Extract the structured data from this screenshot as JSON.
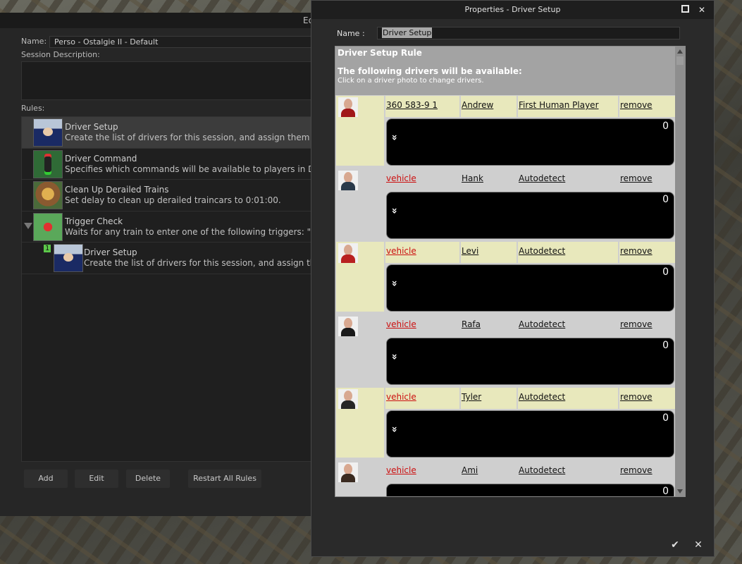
{
  "back_window": {
    "title_fragment": "Ed",
    "name_label": "Name:",
    "name_value": "Perso - Ostalgie II - Default",
    "session_description_label": "Session Description:",
    "rules_label": "Rules:",
    "rules": [
      {
        "title": "Driver Setup",
        "desc": "Create the list of drivers for this session, and assign them their o"
      },
      {
        "title": "Driver Command",
        "desc": "Specifies which commands will be available to players in Driver."
      },
      {
        "title": "Clean Up Derailed Trains",
        "desc": "Set delay to clean up derailed traincars to 0:01:00."
      },
      {
        "title": "Trigger Check",
        "desc": "Waits for any train to enter one of the following triggers: \"Cahlew"
      },
      {
        "title": "Driver Setup",
        "desc": "Create the list of drivers for this session, and assign them th",
        "child_index": "1"
      }
    ],
    "buttons": {
      "add": "Add",
      "edit": "Edit",
      "delete": "Delete",
      "restart": "Restart All Rules"
    }
  },
  "properties": {
    "title": "Properties - Driver Setup",
    "name_label": "Name :",
    "name_value": "Driver Setup",
    "header_title": "Driver Setup Rule",
    "header_subtitle": "The following drivers will be available:",
    "header_hint": "Click on a driver photo to change drivers.",
    "drivers": [
      {
        "vehicle": "360 583-9 1",
        "name": "Andrew",
        "control": "First Human Player",
        "remove": "remove",
        "count": "0",
        "vehicle_red": false
      },
      {
        "vehicle": "vehicle",
        "name": "Hank",
        "control": "Autodetect",
        "remove": "remove",
        "count": "0",
        "vehicle_red": true
      },
      {
        "vehicle": "vehicle",
        "name": "Levi",
        "control": "Autodetect",
        "remove": "remove",
        "count": "0",
        "vehicle_red": true
      },
      {
        "vehicle": "vehicle",
        "name": "Rafa",
        "control": "Autodetect",
        "remove": "remove",
        "count": "0",
        "vehicle_red": true
      },
      {
        "vehicle": "vehicle",
        "name": "Tyler",
        "control": "Autodetect",
        "remove": "remove",
        "count": "0",
        "vehicle_red": true
      },
      {
        "vehicle": "vehicle",
        "name": "Ami",
        "control": "Autodetect",
        "remove": "remove",
        "count": "0",
        "vehicle_red": true
      }
    ],
    "icons": {
      "restore": "restore-icon",
      "close": "close-icon",
      "ok": "checkmark-icon",
      "cancel": "cancel-icon",
      "expand": "chevron-icon"
    }
  }
}
